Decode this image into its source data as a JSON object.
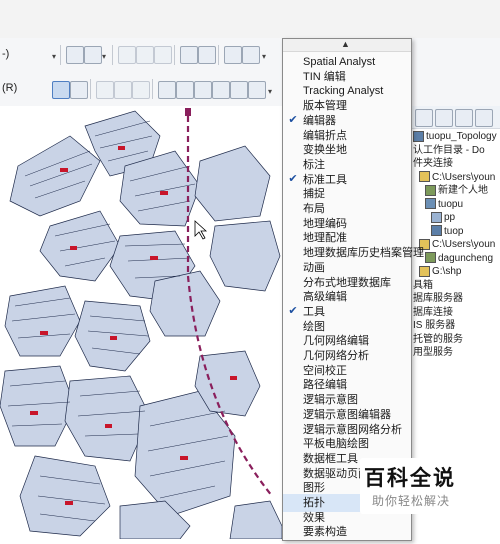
{
  "colors": {
    "parcel_fill": "#c9d3e6",
    "parcel_stroke": "#1e2a4a",
    "parcel_highlight": "#c8152a",
    "annotation_arrow": "#8a1f5c",
    "check_blue": "#1c4fa0",
    "menu_bg": "#fafafa",
    "menu_highlight": "#d8e6f7"
  },
  "toolbar": {
    "row1_label": "-)",
    "row2_label": "(R)"
  },
  "menu": {
    "items": [
      {
        "label": "Spatial Analyst",
        "checked": false
      },
      {
        "label": "TIN 编辑",
        "checked": false
      },
      {
        "label": "Tracking Analyst",
        "checked": false
      },
      {
        "label": "版本管理",
        "checked": false
      },
      {
        "label": "编辑器",
        "checked": true
      },
      {
        "label": "编辑折点",
        "checked": false
      },
      {
        "label": "变换坐地",
        "checked": false
      },
      {
        "label": "标注",
        "checked": false
      },
      {
        "label": "标准工具",
        "checked": true
      },
      {
        "label": "捕捉",
        "checked": false
      },
      {
        "label": "布局",
        "checked": false
      },
      {
        "label": "地理编码",
        "checked": false
      },
      {
        "label": "地理配准",
        "checked": false
      },
      {
        "label": "地理数据库历史档案管理",
        "checked": false
      },
      {
        "label": "动画",
        "checked": false
      },
      {
        "label": "分布式地理数据库",
        "checked": false
      },
      {
        "label": "高级编辑",
        "checked": false
      },
      {
        "label": "工具",
        "checked": true
      },
      {
        "label": "绘图",
        "checked": false
      },
      {
        "label": "几何网络编辑",
        "checked": false
      },
      {
        "label": "几何网络分析",
        "checked": false
      },
      {
        "label": "空间校正",
        "checked": false
      },
      {
        "label": "路径编辑",
        "checked": false
      },
      {
        "label": "逻辑示意图",
        "checked": false
      },
      {
        "label": "逻辑示意图编辑器",
        "checked": false
      },
      {
        "label": "逻辑示意图网络分析",
        "checked": false
      },
      {
        "label": "平板电脑绘图",
        "checked": false
      },
      {
        "label": "数据框工具",
        "checked": false
      },
      {
        "label": "数据驱动页面",
        "checked": false
      },
      {
        "label": "图形",
        "checked": false
      },
      {
        "label": "拓扑",
        "checked": false
      },
      {
        "label": "效果",
        "checked": false
      },
      {
        "label": "要素构造",
        "checked": false
      }
    ]
  },
  "catalog": {
    "items": [
      {
        "label": "tuopu_Topology",
        "indent": 0,
        "icon": "topology-icon"
      },
      {
        "label": "认工作目录 - Do",
        "indent": 0,
        "icon": ""
      },
      {
        "label": "件夹连接",
        "indent": 0,
        "icon": ""
      },
      {
        "label": "C:\\Users\\youn",
        "indent": 1,
        "icon": "folder-icon"
      },
      {
        "label": "新建个人地",
        "indent": 2,
        "icon": "database-icon"
      },
      {
        "label": "tuopu",
        "indent": 2,
        "icon": "dataset-icon"
      },
      {
        "label": "pp",
        "indent": 3,
        "icon": "feature-class-icon"
      },
      {
        "label": "tuop",
        "indent": 3,
        "icon": "topology-icon"
      },
      {
        "label": "C:\\Users\\youn",
        "indent": 1,
        "icon": "folder-icon"
      },
      {
        "label": "daguncheng",
        "indent": 2,
        "icon": "database-icon"
      },
      {
        "label": "G:\\shp",
        "indent": 1,
        "icon": "folder-icon"
      },
      {
        "label": "具箱",
        "indent": 0,
        "icon": ""
      },
      {
        "label": "据库服务器",
        "indent": 0,
        "icon": ""
      },
      {
        "label": "据库连接",
        "indent": 0,
        "icon": ""
      },
      {
        "label": "IS 服务器",
        "indent": 0,
        "icon": ""
      },
      {
        "label": "托管的服务",
        "indent": 0,
        "icon": ""
      },
      {
        "label": "用型服务",
        "indent": 0,
        "icon": ""
      }
    ]
  },
  "watermark": {
    "title": "百科全说",
    "subtitle": "助你轻松解决"
  }
}
